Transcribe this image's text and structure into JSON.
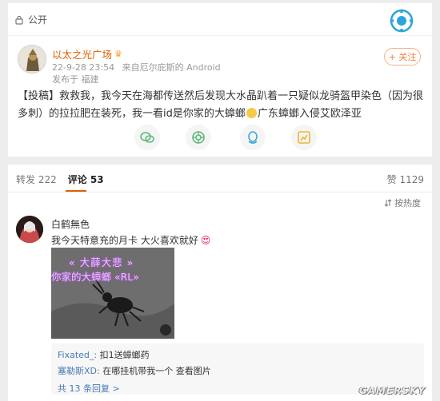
{
  "post": {
    "visibility": "公开",
    "author": {
      "name": "以太之光广场"
    },
    "timestamp": "22-9-28 23:54",
    "source": "来自厄尔庇斯的 Android",
    "location": "发布于 福建",
    "follow_label": "+ 关注",
    "text_before_emoji": "【投稿】救救我，我今天在海都传送然后发现大水晶趴着一只疑似龙骑盔甲染色（因为很多刺）的拉拉肥在装死，我一看id是你家的大蟑螂",
    "text_after_emoji": "广东蟑螂入侵艾欧泽亚",
    "share_icons": [
      "wechat-icon",
      "moments-icon",
      "qq-icon",
      "qzone-icon"
    ]
  },
  "comments": {
    "tabs": [
      {
        "label": "转发 222"
      },
      {
        "label": "评论 53"
      }
    ],
    "likes": "赞 1129",
    "sort_label": "按热度",
    "items": [
      {
        "user": "白鹤無色",
        "text": "我今天特意充的月卡 大火喜欢就好",
        "image": {
          "line1": "« 大薛大悲 »",
          "line2": "你家的大蟑螂 «RL»"
        },
        "replies": [
          {
            "name": "Fixated_:",
            "text": " 扣1送蟑螂药"
          },
          {
            "name": "塞勒斯XD:",
            "text": " 在哪挂机带我一个 查看图片"
          }
        ],
        "more": "共 13 条回复 >"
      }
    ]
  },
  "watermark": "GAMERSKY",
  "colors": {
    "accent": "#e05f00",
    "link": "#4a78b5",
    "background": "#ededed"
  }
}
